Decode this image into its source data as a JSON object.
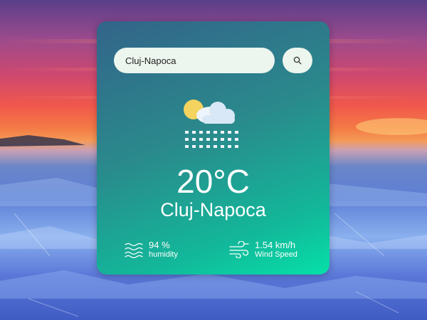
{
  "search": {
    "value": "Cluj-Napoca",
    "button_icon": "search-icon"
  },
  "weather": {
    "icon": "partly-cloudy-snow-icon",
    "temperature": "20°C",
    "city": "Cluj-Napoca",
    "humidity_value": "94 %",
    "humidity_label": "humidity",
    "humidity_icon": "humidity-waves-icon",
    "wind_value": "1.54 km/h",
    "wind_label": "Wind Speed",
    "wind_icon": "wind-icon"
  },
  "colors": {
    "card_top": "#33648a",
    "card_bottom": "#06e0a8",
    "sun": "#f4d35e",
    "cloud": "#d8e8f6"
  }
}
